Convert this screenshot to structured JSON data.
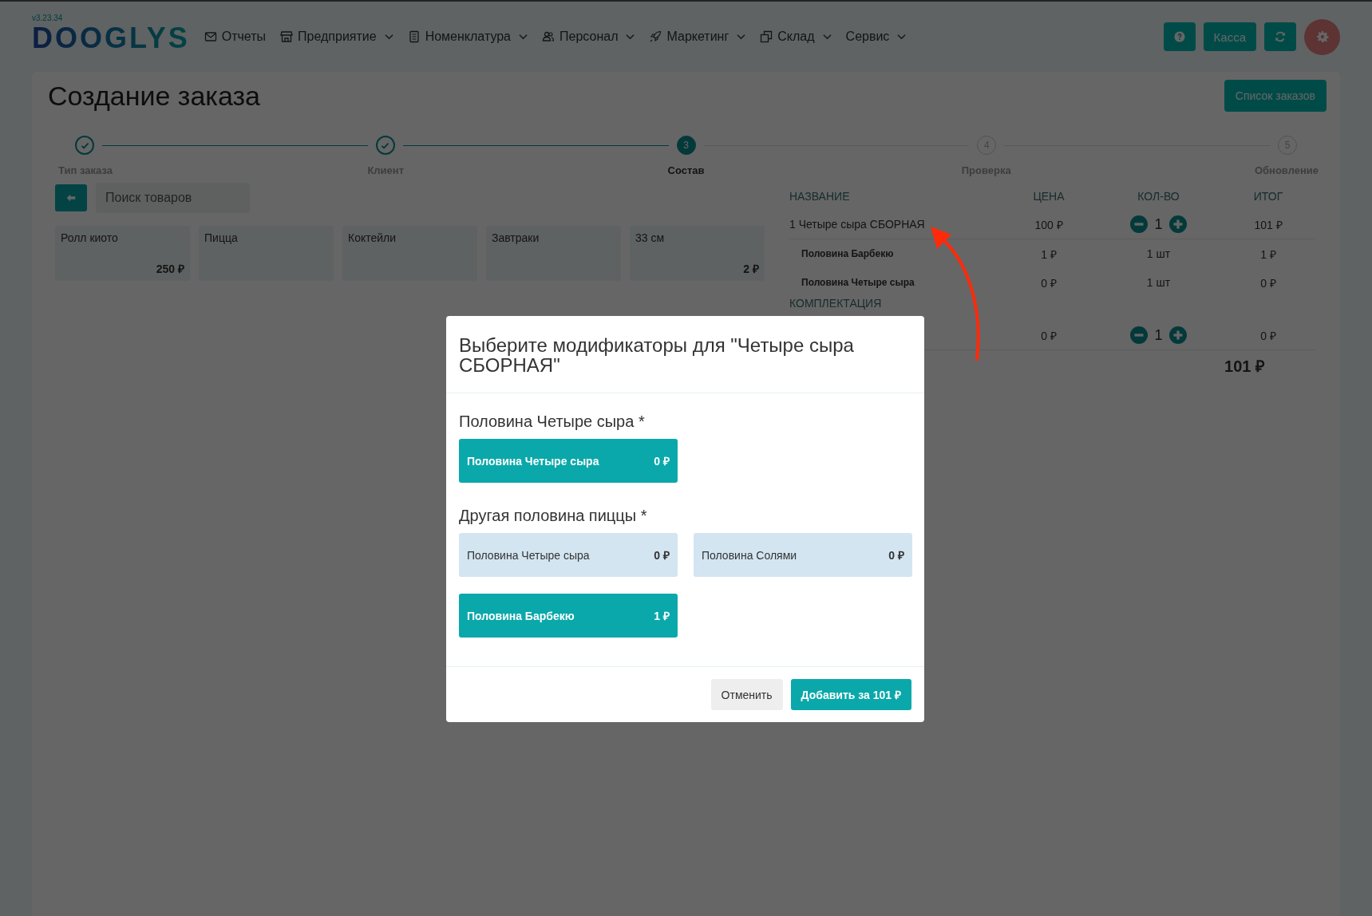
{
  "version": "v3.23.34",
  "logo": "DOOGLYS",
  "nav": [
    {
      "label": "Отчеты",
      "dropdown": false
    },
    {
      "label": "Предприятие",
      "dropdown": true
    },
    {
      "label": "Номенклатура",
      "dropdown": true
    },
    {
      "label": "Персонал",
      "dropdown": true
    },
    {
      "label": "Маркетинг",
      "dropdown": true
    },
    {
      "label": "Склад",
      "dropdown": true
    },
    {
      "label": "Сервис",
      "dropdown": true
    }
  ],
  "header_buttons": {
    "cash": "Касса"
  },
  "page": {
    "title": "Создание заказа",
    "orders_button": "Список заказов"
  },
  "steps": [
    {
      "label": "Тип заказа",
      "done": true,
      "selected": false
    },
    {
      "label": "Клиент",
      "done": true,
      "selected": false
    },
    {
      "number": "3",
      "label": "Состав",
      "done": false,
      "selected": true
    },
    {
      "number": "4",
      "label": "Проверка",
      "done": false,
      "selected": false
    },
    {
      "number": "5",
      "label": "Обновление",
      "done": false,
      "selected": false
    }
  ],
  "search": {
    "placeholder": "Поиск товаров"
  },
  "categories": [
    {
      "name": "Ролл киото",
      "price": "250 ₽"
    },
    {
      "name": "Пицца"
    },
    {
      "name": "Коктейли"
    },
    {
      "name": "Завтраки"
    },
    {
      "name": "33 см",
      "price": "2 ₽"
    }
  ],
  "order_table": {
    "columns": [
      "НАЗВАНИЕ",
      "ЦЕНА",
      "КОЛ-ВО",
      "ИТОГ"
    ],
    "rows": [
      {
        "kind": "item",
        "name": "1 Четыре сыра СБОРНАЯ",
        "price": "100 ₽",
        "qty": "1",
        "total": "101 ₽"
      },
      {
        "kind": "modifier",
        "name": "Половина Барбекю",
        "price": "1 ₽",
        "qty": "1 шт",
        "total": "1 ₽"
      },
      {
        "kind": "modifier",
        "name": "Половина Четыре сыра",
        "price": "0 ₽",
        "qty": "1 шт",
        "total": "0 ₽"
      },
      {
        "kind": "section",
        "name": "КОМПЛЕКТАЦИЯ"
      },
      {
        "kind": "item",
        "price": "0 ₽",
        "qty": "1",
        "total": "0 ₽"
      }
    ],
    "total": "101 ₽"
  },
  "modal": {
    "title": "Выберите модификаторы для \"Четыре сыра СБОРНАЯ\"",
    "groups": [
      {
        "title": "Половина Четыре сыра *",
        "options": [
          {
            "name": "Половина Четыре сыра",
            "price": "0 ₽",
            "selected": true
          }
        ]
      },
      {
        "title": "Другая половина пиццы *",
        "options": [
          {
            "name": "Половина Четыре сыра",
            "price": "0 ₽",
            "selected": false
          },
          {
            "name": "Половина Солями",
            "price": "0 ₽",
            "selected": false
          },
          {
            "name": "Половина Барбекю",
            "price": "1 ₽",
            "selected": true
          }
        ]
      }
    ],
    "cancel": "Отменить",
    "submit": "Добавить за 101 ₽"
  }
}
